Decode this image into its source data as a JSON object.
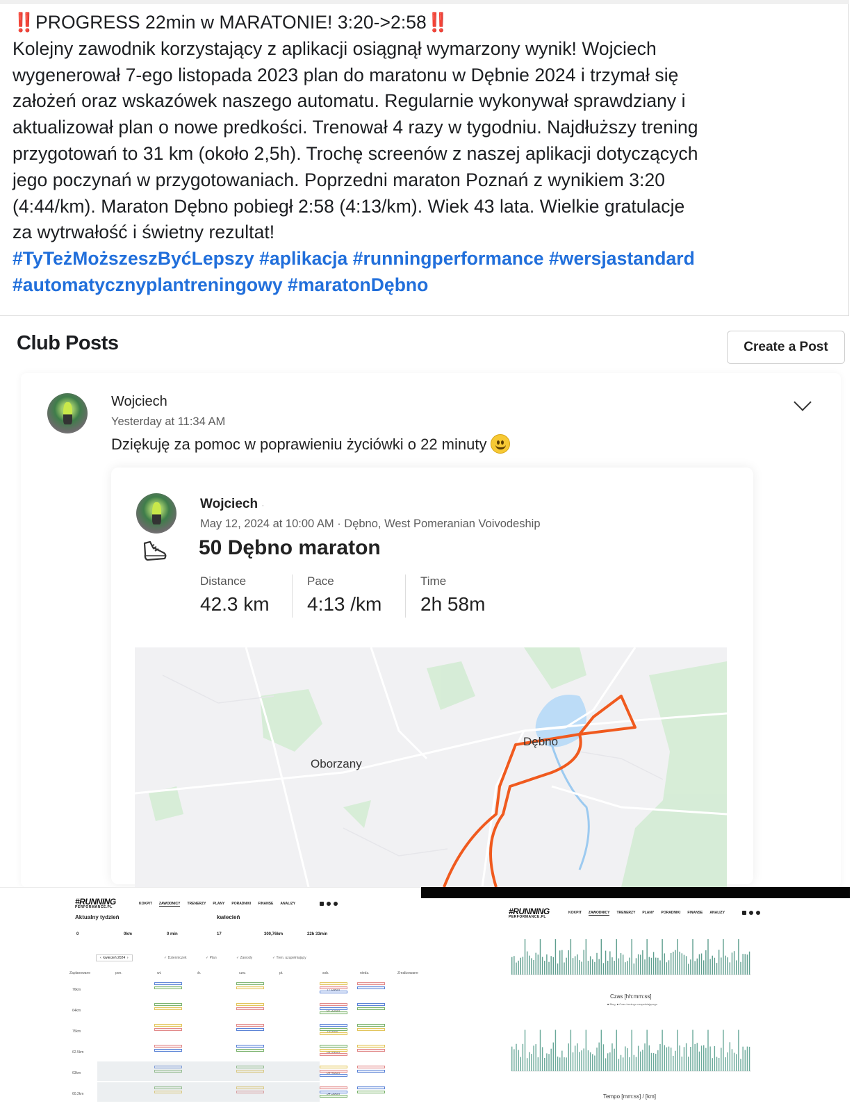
{
  "post": {
    "line1_prefix": "‼️",
    "line1_text": "PROGRESS 22min w MARATONIE! 3:20->2:58",
    "line1_suffix": "‼️",
    "lines": [
      "Kolejny zawodnik korzystający z aplikacji osiągnął wymarzony wynik! Wojciech",
      "wygenerował 7-ego listopada 2023 plan do maratonu w Dębnie 2024 i trzymał się",
      "założeń oraz wskazówek naszego automatu. Regularnie wykonywał sprawdziany i",
      "aktualizował plan o nowe predkości. Trenował 4 razy w tygodniu. Najdłuższy trening",
      "przygotowań to 31 km (około 2,5h). Trochę screenów z naszej aplikacji dotyczących",
      "jego poczynań w przygotowaniach. Poprzedni maraton Poznań z wynikiem 3:20",
      "(4:44/km). Maraton Dębno pobiegł 2:58 (4:13/km). Wiek 43 lata. Wielkie gratulacje",
      "za wytrwałość i świetny rezultat!"
    ],
    "hashtags_line1": "#TyTeżMoższeszByćLepszy #aplikacja #runningperformance #wersjastandard",
    "hashtags_line2": "#automatycznyplantreningowy #maratonDębno"
  },
  "club": {
    "header": "Club Posts",
    "create_button": "Create a Post",
    "post_author": "Wojciech",
    "post_time": "Yesterday at 11:34 AM",
    "post_message": "Dziękuję za pomoc w poprawieniu życiówki o 22 minuty",
    "activity": {
      "author": "Wojciech",
      "author_suffix": "·",
      "datetime": "May 12, 2024 at 10:00 AM · Dębno, West Pomeranian Voivodeship",
      "title": "50 Dębno maraton",
      "stats": [
        {
          "label": "Distance",
          "value": "42.3 km"
        },
        {
          "label": "Pace",
          "value": "4:13 /km"
        },
        {
          "label": "Time",
          "value": "2h 58m"
        }
      ],
      "map_labels": {
        "town1": "Oborzany",
        "town2": "Dębno"
      },
      "icon": "running-shoe-icon"
    }
  },
  "app_left": {
    "logo": "#RUNNING",
    "logo_sub": "PERFORMANCE.PL",
    "nav": [
      "KOKPIT",
      "ZAWODNICY",
      "TRENERZY",
      "PLANY",
      "PORADNIKI",
      "FINANSE",
      "ANALIZY"
    ],
    "week_title": "Aktualny tydzień",
    "month_title": "kwiecień",
    "week_values": [
      "0",
      "0km",
      "0 min"
    ],
    "month_values": [
      "17",
      "300,76km",
      "22h 33min"
    ],
    "month_nav": "kwiecień 2024",
    "filters": [
      "Dzienniczek",
      "Plan",
      "Zawody",
      "Tren. uzupełniający"
    ],
    "day_headers": [
      "Zaplanowane",
      "pon.",
      "wt.",
      "śr.",
      "czw.",
      "pt.",
      "sob.",
      "niedz.",
      "Zrealizowane"
    ],
    "planned": [
      "76km",
      "64km",
      "75km",
      "62.5km",
      "63km",
      "60.2km"
    ],
    "realized": [
      "77.89km",
      "67.22km",
      "76.2km",
      "64.44km",
      "64.48km",
      "54.38km"
    ]
  },
  "app_right": {
    "logo": "#RUNNING",
    "logo_sub": "PERFORMANCE.PL",
    "nav": [
      "KOKPIT",
      "ZAWODNICY",
      "TRENERZY",
      "PLANY",
      "PORADNIKI",
      "FINANSE",
      "ANALIZY"
    ],
    "chart2_title": "Czas [hh:mm:ss]",
    "chart3_title": "Tempo [mm:ss] / [km]",
    "legend": [
      "Bieg",
      "Czas treningu uzupełniającego"
    ]
  }
}
